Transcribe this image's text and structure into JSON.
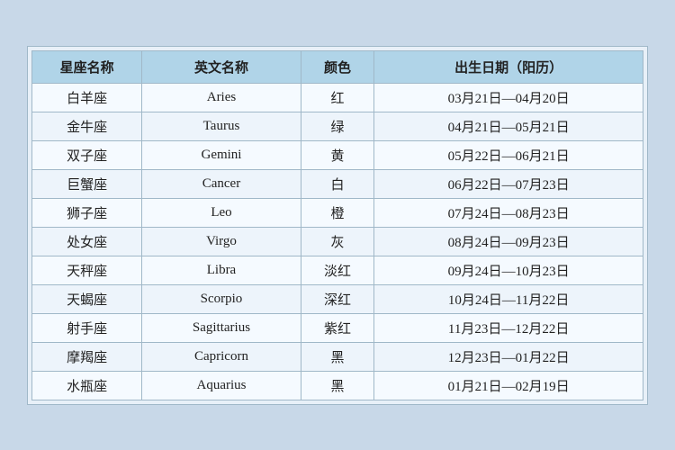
{
  "table": {
    "headers": [
      "星座名称",
      "英文名称",
      "颜色",
      "出生日期（阳历）"
    ],
    "rows": [
      {
        "chinese": "白羊座",
        "english": "Aries",
        "color": "红",
        "date": "03月21日—04月20日"
      },
      {
        "chinese": "金牛座",
        "english": "Taurus",
        "color": "绿",
        "date": "04月21日—05月21日"
      },
      {
        "chinese": "双子座",
        "english": "Gemini",
        "color": "黄",
        "date": "05月22日—06月21日"
      },
      {
        "chinese": "巨蟹座",
        "english": "Cancer",
        "color": "白",
        "date": "06月22日—07月23日"
      },
      {
        "chinese": "狮子座",
        "english": "Leo",
        "color": "橙",
        "date": "07月24日—08月23日"
      },
      {
        "chinese": "处女座",
        "english": "Virgo",
        "color": "灰",
        "date": "08月24日—09月23日"
      },
      {
        "chinese": "天秤座",
        "english": "Libra",
        "color": "淡红",
        "date": "09月24日—10月23日"
      },
      {
        "chinese": "天蝎座",
        "english": "Scorpio",
        "color": "深红",
        "date": "10月24日—11月22日"
      },
      {
        "chinese": "射手座",
        "english": "Sagittarius",
        "color": "紫红",
        "date": "11月23日—12月22日"
      },
      {
        "chinese": "摩羯座",
        "english": "Capricorn",
        "color": "黑",
        "date": "12月23日—01月22日"
      },
      {
        "chinese": "水瓶座",
        "english": "Aquarius",
        "color": "黑",
        "date": "01月21日—02月19日"
      }
    ]
  }
}
